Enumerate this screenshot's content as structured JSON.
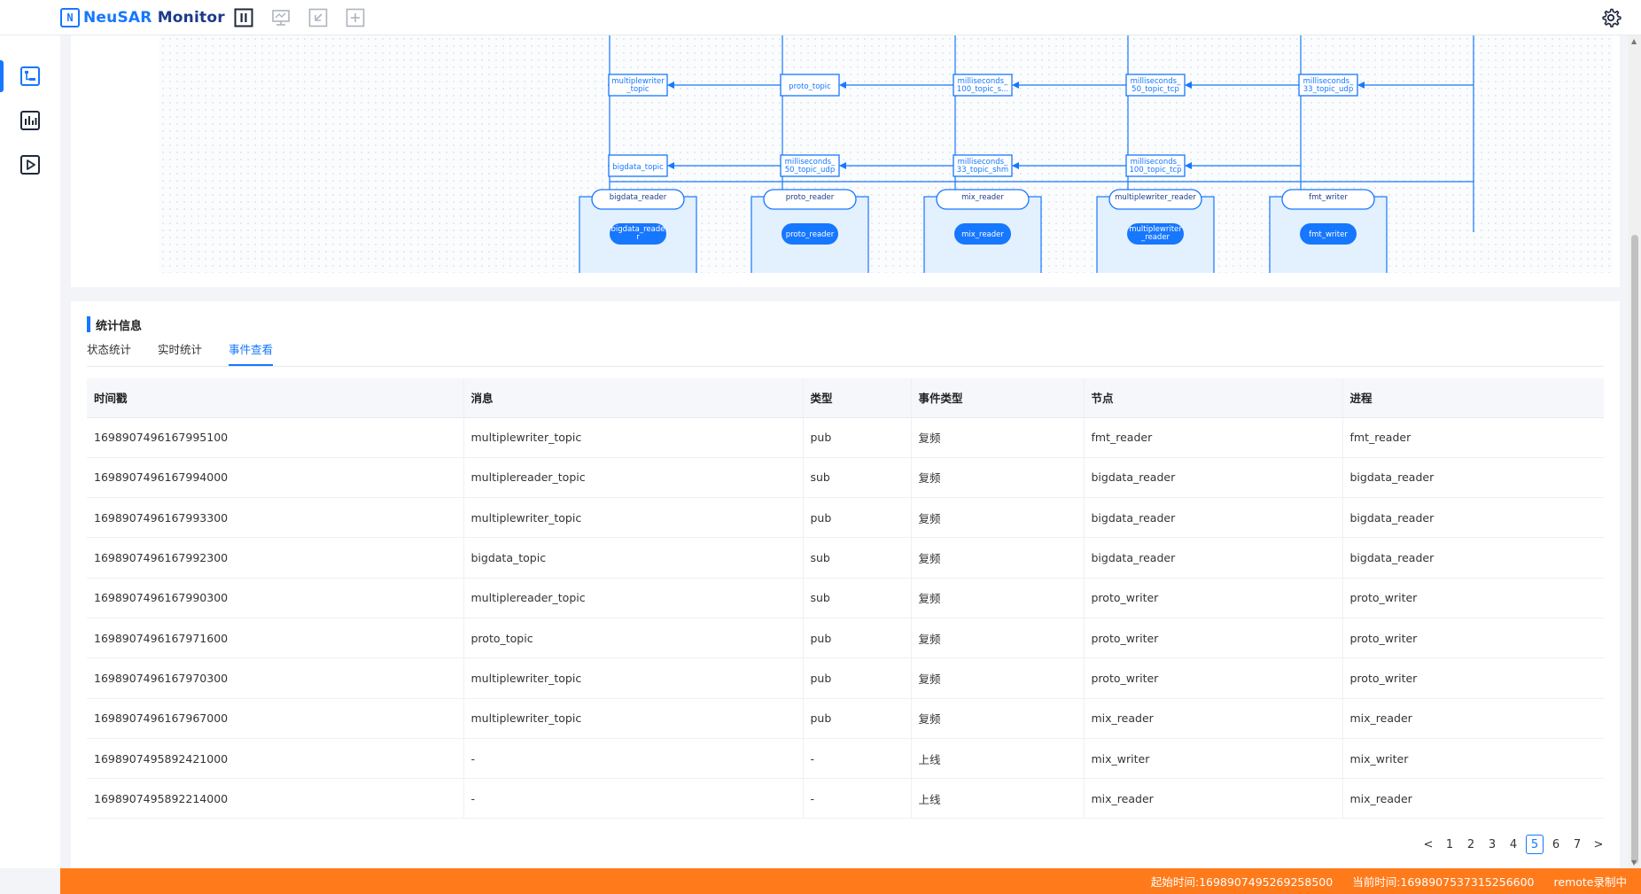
{
  "app": {
    "logo_mark": "N",
    "logo_name_a": "NeuSAR",
    "logo_name_b": "Monitor"
  },
  "graph": {
    "topics_row1": [
      {
        "l1": "multiplewriter",
        "l2": "_topic"
      },
      {
        "l1": "proto_topic",
        "l2": ""
      },
      {
        "l1": "milliseconds_",
        "l2": "100_topic_s..."
      },
      {
        "l1": "milliseconds_",
        "l2": "50_topic_tcp"
      },
      {
        "l1": "milliseconds_",
        "l2": "33_topic_udp"
      }
    ],
    "topics_row2": [
      {
        "l1": "bigdata_topic",
        "l2": ""
      },
      {
        "l1": "milliseconds_",
        "l2": "50_topic_udp"
      },
      {
        "l1": "milliseconds_",
        "l2": "33_topic_shm"
      },
      {
        "l1": "milliseconds_",
        "l2": "100_topic_tcp"
      }
    ],
    "groups": [
      {
        "title": "bigdata_reader",
        "node_l1": "bigdata_reade",
        "node_l2": "r"
      },
      {
        "title": "proto_reader",
        "node_l1": "proto_reader",
        "node_l2": ""
      },
      {
        "title": "mix_reader",
        "node_l1": "mix_reader",
        "node_l2": ""
      },
      {
        "title": "multiplewriter_reader",
        "node_l1": "multiplewriter",
        "node_l2": "_reader"
      },
      {
        "title": "fmt_writer",
        "node_l1": "fmt_writer",
        "node_l2": ""
      }
    ]
  },
  "stats": {
    "title": "统计信息",
    "tabs": [
      "状态统计",
      "实时统计",
      "事件查看"
    ],
    "active_tab": 2,
    "columns": [
      "时间戳",
      "消息",
      "类型",
      "事件类型",
      "节点",
      "进程"
    ],
    "rows": [
      [
        "1698907496167995100",
        "multiplewriter_topic",
        "pub",
        "复频",
        "fmt_reader",
        "fmt_reader"
      ],
      [
        "1698907496167994000",
        "multiplereader_topic",
        "sub",
        "复频",
        "bigdata_reader",
        "bigdata_reader"
      ],
      [
        "1698907496167993300",
        "multiplewriter_topic",
        "pub",
        "复频",
        "bigdata_reader",
        "bigdata_reader"
      ],
      [
        "1698907496167992300",
        "bigdata_topic",
        "sub",
        "复频",
        "bigdata_reader",
        "bigdata_reader"
      ],
      [
        "1698907496167990300",
        "multiplereader_topic",
        "sub",
        "复频",
        "proto_writer",
        "proto_writer"
      ],
      [
        "1698907496167971600",
        "proto_topic",
        "pub",
        "复频",
        "proto_writer",
        "proto_writer"
      ],
      [
        "1698907496167970300",
        "multiplewriter_topic",
        "pub",
        "复频",
        "proto_writer",
        "proto_writer"
      ],
      [
        "1698907496167967000",
        "multiplewriter_topic",
        "pub",
        "复频",
        "mix_reader",
        "mix_reader"
      ],
      [
        "1698907495892421000",
        "-",
        "-",
        "上线",
        "mix_writer",
        "mix_writer"
      ],
      [
        "1698907495892214000",
        "-",
        "-",
        "上线",
        "mix_reader",
        "mix_reader"
      ]
    ],
    "pagination": {
      "prev": "<",
      "next": ">",
      "pages": [
        "1",
        "2",
        "3",
        "4",
        "5",
        "6",
        "7"
      ],
      "current": "5"
    }
  },
  "status_bar": {
    "start": "起始时间:1698907495269258500",
    "current": "当前时间:1698907537315256600",
    "mode": "remote录制中"
  },
  "colors": {
    "accent": "#1677ff",
    "status_bar": "#ff7a1a"
  },
  "icons": {
    "toolbar": [
      "pause-icon",
      "monitor-icon",
      "back-arrow-icon",
      "plus-icon"
    ],
    "rail": [
      "topology-icon",
      "chart-icon",
      "play-icon"
    ],
    "top_right": "settings-gear-icon"
  }
}
